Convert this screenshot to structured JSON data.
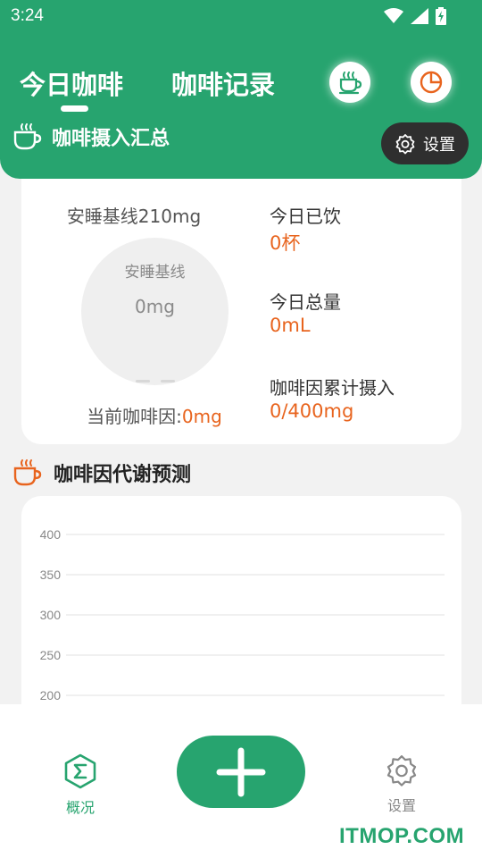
{
  "status_bar": {
    "time": "3:24",
    "icons": [
      "wifi-icon",
      "signal-icon",
      "battery-icon"
    ]
  },
  "header": {
    "tabs": [
      {
        "label": "今日咖啡",
        "active": true
      },
      {
        "label": "咖啡记录",
        "active": false
      }
    ],
    "summary_title": "咖啡摄入汇总",
    "settings_label": "设置"
  },
  "summary": {
    "baseline_label": "安睡基线210mg",
    "gauge_label": "安睡基线",
    "gauge_value": "0mg",
    "current_label": "当前咖啡因:",
    "current_value": "0mg",
    "stats": [
      {
        "label": "今日已饮",
        "value": "0杯"
      },
      {
        "label": "今日总量",
        "value": "0mL"
      },
      {
        "label": "咖啡因累计摄入",
        "value": "0/400mg"
      }
    ]
  },
  "metabolism": {
    "title": "咖啡因代谢预测"
  },
  "chart_data": {
    "type": "line",
    "title": "",
    "xlabel": "",
    "ylabel": "",
    "y_ticks": [
      400,
      350,
      300,
      250,
      200
    ],
    "series": []
  },
  "bottom_nav": {
    "overview_label": "概况",
    "settings_label": "设置"
  },
  "watermark": "ITMOP.COM",
  "colors": {
    "primary": "#27a46f",
    "accent": "#e8641e",
    "dark_pill": "#2f2f2f"
  }
}
